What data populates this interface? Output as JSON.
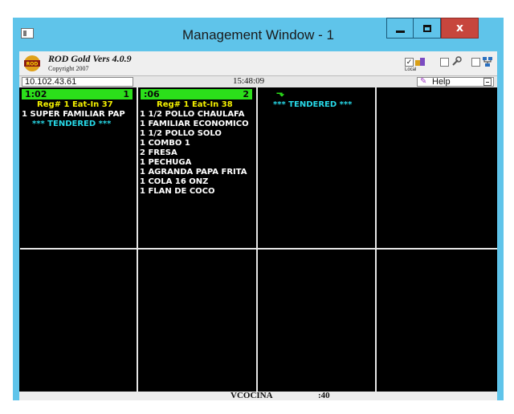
{
  "window": {
    "title": "Management Window - 1"
  },
  "toolbar": {
    "app_name": "ROD Gold Vers 4.0.9",
    "copyright": "Copyright 2007",
    "logo_text": "ROD",
    "local_label": "Local",
    "local_checked": true
  },
  "addressbar": {
    "ip": "10.102.43.61",
    "clock": "15:48:09",
    "help": "Help"
  },
  "orders": [
    {
      "time": "1:02",
      "number": "1",
      "reg": "Reg# 1 Eat-In  37",
      "items": [
        "1 SUPER FAMILIAR PAP"
      ],
      "tendered": "*** TENDERED ***"
    },
    {
      "time": ":06",
      "number": "2",
      "reg": "Reg# 1 Eat-In  38",
      "items": [
        "1 1/2 POLLO CHAULAFA",
        "1 FAMILIAR ECONOMICO",
        "1 1/2 POLLO SOLO",
        "1 COMBO 1",
        "2 FRESA",
        "1 PECHUGA",
        "1 AGRANDA PAPA FRITA",
        "1 COLA 16 ONZ",
        "1 FLAN DE COCO"
      ]
    },
    {
      "tendered": "*** TENDERED ***"
    }
  ],
  "status": {
    "station": "VCOCINA",
    "value": ":40"
  },
  "colors": {
    "titlebar": "#5fc4ea",
    "close": "#c7463d",
    "order_header": "#2be01a",
    "reg_text": "#f4f000",
    "tendered_text": "#27d9e8",
    "screen_bg": "#000000"
  },
  "icons": [
    "app-icon",
    "rod-logo-icon",
    "local-icon",
    "tool-icon",
    "network-icon",
    "help-icon",
    "dropdown-icon",
    "arrow-down-icon"
  ]
}
